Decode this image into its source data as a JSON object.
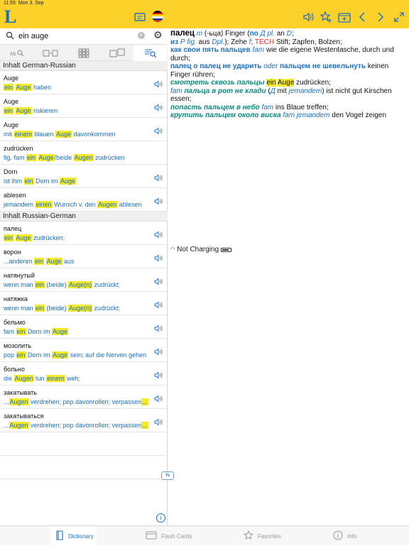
{
  "status": {
    "time": "11:55",
    "date": "Mon 3. Sep",
    "charging": "Not Charging"
  },
  "app": {
    "logo": "L"
  },
  "search": {
    "value": "ein auge",
    "placeholder": ""
  },
  "sections": [
    {
      "title": "Inhalt German-Russian",
      "rows": [
        {
          "headword": "Auge",
          "example": [
            [
              "ein",
              true
            ],
            [
              " ",
              false
            ],
            [
              "Auge",
              true
            ],
            [
              " haben",
              false
            ]
          ]
        },
        {
          "headword": "Auge",
          "example": [
            [
              "ein",
              true
            ],
            [
              " ",
              false
            ],
            [
              "Auge",
              true
            ],
            [
              " riskieren",
              false
            ]
          ]
        },
        {
          "headword": "Auge",
          "example": [
            [
              "mit ",
              false
            ],
            [
              "einem",
              true
            ],
            [
              " blauen ",
              false
            ],
            [
              "Auge",
              true
            ],
            [
              " davonkommen",
              false
            ]
          ]
        },
        {
          "headword": "zudrücken",
          "example": [
            [
              "fig. fam ",
              false
            ],
            [
              "ein",
              true
            ],
            [
              " ",
              false
            ],
            [
              "Auge",
              true
            ],
            [
              "/beide ",
              false
            ],
            [
              "Augen",
              true
            ],
            [
              " zudrücken",
              false
            ]
          ],
          "no_audio": true
        },
        {
          "headword": "Dorn",
          "example": [
            [
              "ist ihm ",
              false
            ],
            [
              "ein",
              true
            ],
            [
              " Dorn im ",
              false
            ],
            [
              "Auge",
              true
            ]
          ]
        },
        {
          "headword": "ablesen",
          "example": [
            [
              "jemandem ",
              false
            ],
            [
              "einen",
              true
            ],
            [
              " Wunsch v. den ",
              false
            ],
            [
              "Augen",
              true
            ],
            [
              " ablesen",
              false
            ]
          ]
        }
      ]
    },
    {
      "title": "Inhalt Russian-German",
      "rows": [
        {
          "headword": "палец",
          "example": [
            [
              "ein",
              true
            ],
            [
              " ",
              false
            ],
            [
              "Auge",
              true
            ],
            [
              " zudrücken;",
              false
            ]
          ]
        },
        {
          "headword": "ворон",
          "example": [
            [
              "...anderen ",
              false
            ],
            [
              "ein",
              true
            ],
            [
              " ",
              false
            ],
            [
              "Auge",
              true
            ],
            [
              " aus",
              false
            ]
          ]
        },
        {
          "headword": "натянутый",
          "example": [
            [
              "wenn man ",
              false
            ],
            [
              "ein",
              true
            ],
            [
              " (beide) ",
              false
            ],
            [
              "Auge(n)",
              true
            ],
            [
              " zudrückt;",
              false
            ]
          ]
        },
        {
          "headword": "натяжка",
          "example": [
            [
              "wenn man ",
              false
            ],
            [
              "ein",
              true
            ],
            [
              " (beide) ",
              false
            ],
            [
              "Auge(n)",
              true
            ],
            [
              " zudrückt;",
              false
            ]
          ]
        },
        {
          "headword": "бельмо",
          "example": [
            [
              "fam ",
              false
            ],
            [
              "ein",
              true
            ],
            [
              " Dorn im ",
              false
            ],
            [
              "Auge",
              true
            ]
          ]
        },
        {
          "headword": "мозолить",
          "example": [
            [
              "pop ",
              false
            ],
            [
              "ein",
              true
            ],
            [
              " Dorn im ",
              false
            ],
            [
              "Auge",
              true
            ],
            [
              " sein; auf die Nerven gehen",
              false
            ]
          ]
        },
        {
          "headword": "больно",
          "example": [
            [
              "die ",
              false
            ],
            [
              "Augen",
              true
            ],
            [
              " tun ",
              false
            ],
            [
              "einem",
              true
            ],
            [
              " weh;",
              false
            ]
          ]
        },
        {
          "headword": "закатывать",
          "example": [
            [
              "...",
              false
            ],
            [
              "Augen",
              true
            ],
            [
              " verdrehen; pop davonrollen; verpassen",
              false
            ],
            [
              "...",
              true
            ]
          ]
        },
        {
          "headword": "закатываться",
          "example": [
            [
              "...",
              false
            ],
            [
              "Augen",
              true
            ],
            [
              " verdrehen; pop davonrollen; verpassen",
              false
            ],
            [
              "...",
              true
            ]
          ]
        }
      ]
    }
  ],
  "entry": [
    [
      [
        "палец",
        "head"
      ],
      [
        " ",
        "t"
      ],
      [
        "m",
        "i"
      ],
      [
        " (-ьца) Finger (",
        "t"
      ],
      [
        "по",
        "b"
      ],
      [
        " ",
        "t"
      ],
      [
        "Д",
        "i"
      ],
      [
        " ",
        "t"
      ],
      [
        "pl.",
        "i"
      ],
      [
        " an ",
        "t"
      ],
      [
        "D",
        "i"
      ],
      [
        ";",
        "t"
      ]
    ],
    [
      [
        "из",
        "b"
      ],
      [
        " ",
        "t"
      ],
      [
        "P",
        "i"
      ],
      [
        " ",
        "t"
      ],
      [
        "fig.",
        "i"
      ],
      [
        " aus ",
        "t"
      ],
      [
        "Dpl.",
        "i"
      ],
      [
        "); Zehe ",
        "t"
      ],
      [
        "f",
        "i"
      ],
      [
        "; ",
        "t"
      ],
      [
        "TECH",
        "r"
      ],
      [
        " Stift; Zapfen, Bolzen;",
        "t"
      ]
    ],
    [
      [
        "как свои пять пальцев",
        "b"
      ],
      [
        " ",
        "t"
      ],
      [
        "fam",
        "i"
      ],
      [
        " wie die eigene Westentasche, durch und durch;",
        "t"
      ]
    ],
    [
      [
        "палец о палец не ударить",
        "b"
      ],
      [
        " ",
        "t"
      ],
      [
        "oder",
        "i"
      ],
      [
        " ",
        "t"
      ],
      [
        "пальцем не шевельнуть",
        "b"
      ],
      [
        " keinen Finger rühren;",
        "t"
      ]
    ],
    [
      [
        "смотреть сквозь пальцы",
        "g"
      ],
      [
        " ",
        "t"
      ],
      [
        "ein",
        "h"
      ],
      [
        " ",
        "t"
      ],
      [
        "Auge",
        "h"
      ],
      [
        " zudrücken;",
        "t"
      ]
    ],
    [
      [
        "fam",
        "i"
      ],
      [
        " ",
        "t"
      ],
      [
        "пальца в рот не клади",
        "g"
      ],
      [
        " (",
        "t"
      ],
      [
        "Д",
        "i"
      ],
      [
        " mit ",
        "t"
      ],
      [
        "jemandem",
        "i"
      ],
      [
        ") ist nicht gut Kirschen essen;",
        "t"
      ]
    ],
    [
      [
        "попасть пальцем в небо",
        "g"
      ],
      [
        " ",
        "t"
      ],
      [
        "fam",
        "i"
      ],
      [
        " ins Blaue treffen;",
        "t"
      ]
    ],
    [
      [
        "крутить пальцем около виска",
        "g"
      ],
      [
        " ",
        "t"
      ],
      [
        "fam",
        "i"
      ],
      [
        " ",
        "t"
      ],
      [
        "jemandem",
        "i"
      ],
      [
        " den Vogel zeigen",
        "t"
      ]
    ]
  ],
  "tabs": [
    {
      "label": "Dictionary",
      "icon": "dictionary-icon"
    },
    {
      "label": "Flash Cards",
      "icon": "flashcards-icon"
    },
    {
      "label": "Favorites",
      "icon": "star-icon"
    },
    {
      "label": "Info",
      "icon": "info-icon"
    }
  ],
  "colors": {
    "toolbar": "#fcd12a",
    "accent": "#1f6fc2",
    "highlight": "#f5ea2a",
    "phrase_teal": "#0a8a80",
    "tech_red": "#e23030"
  }
}
